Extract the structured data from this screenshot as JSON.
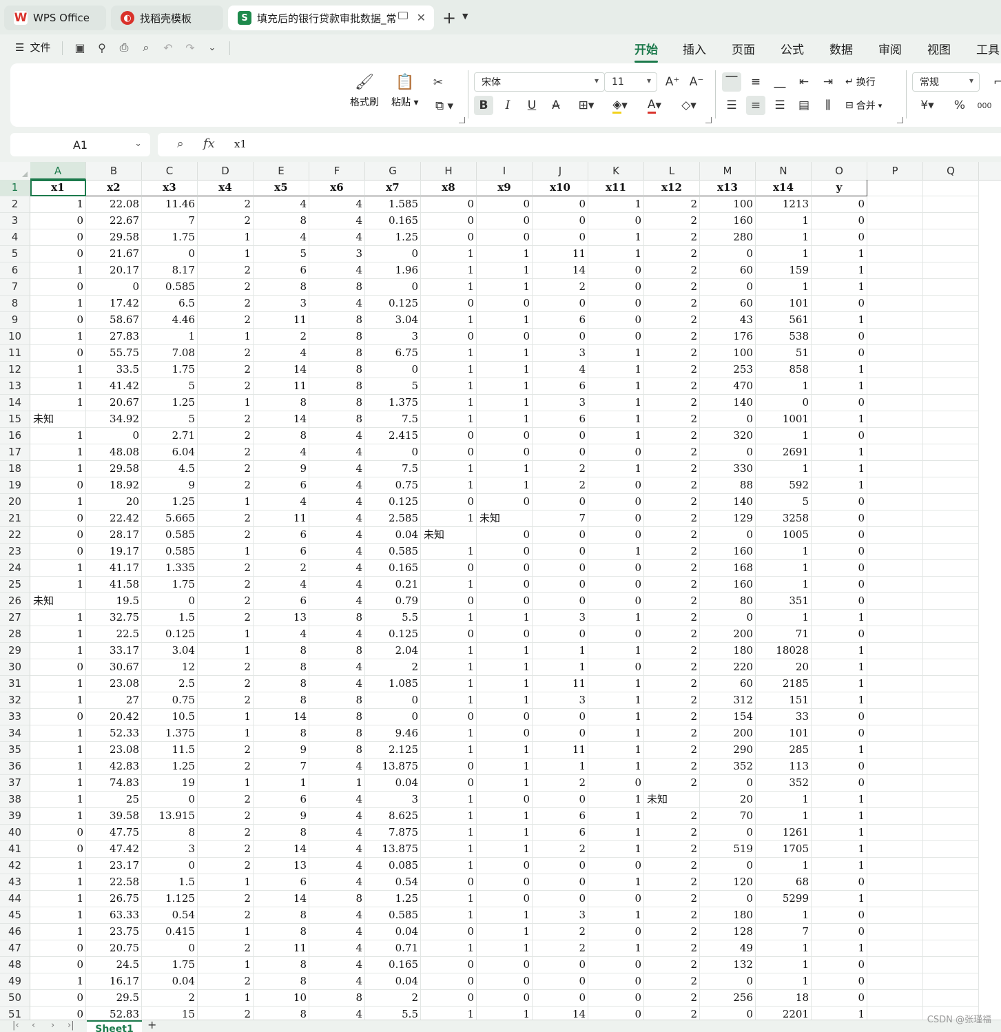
{
  "tabs": [
    {
      "label": "WPS Office",
      "icon": "wps-logo-icon"
    },
    {
      "label": "找稻壳模板",
      "icon": "docer-icon"
    },
    {
      "label": "填充后的银行贷款审批数据_常",
      "icon": "spreadsheet-icon"
    }
  ],
  "menu": {
    "file": "文件",
    "ribbon_tabs": [
      "开始",
      "插入",
      "页面",
      "公式",
      "数据",
      "审阅",
      "视图",
      "工具"
    ],
    "active_tab": "开始"
  },
  "ribbon": {
    "format_painter": "格式刷",
    "paste": "粘贴",
    "font_name": "宋体",
    "font_size": "11",
    "wrap_text": "换行",
    "merge": "合并",
    "number_format": "常规",
    "currency_symbol": "¥",
    "percent_symbol": "%",
    "thousands_symbol": "000"
  },
  "formula_bar": {
    "name_box": "A1",
    "fx": "fx",
    "value": "x1"
  },
  "sheet": {
    "columns": [
      "A",
      "B",
      "C",
      "D",
      "E",
      "F",
      "G",
      "H",
      "I",
      "J",
      "K",
      "L",
      "M",
      "N",
      "O",
      "P",
      "Q"
    ],
    "active_cell": "A1",
    "row_numbers": [
      "1",
      "2",
      "3",
      "4",
      "5",
      "6",
      "7",
      "8",
      "9",
      "10",
      "11",
      "12",
      "13",
      "14",
      "15",
      "16",
      "17",
      "18",
      "19",
      "20",
      "21",
      "22",
      "23",
      "24",
      "25",
      "26",
      "27",
      "28",
      "29",
      "30",
      "31",
      "32",
      "33",
      "34",
      "35",
      "36",
      "37",
      "38",
      "39",
      "40",
      "41",
      "42",
      "43",
      "44",
      "45",
      "46",
      "47",
      "48",
      "49",
      "50",
      "51"
    ],
    "header": [
      "x1",
      "x2",
      "x3",
      "x4",
      "x5",
      "x6",
      "x7",
      "x8",
      "x9",
      "x10",
      "x11",
      "x12",
      "x13",
      "x14",
      "y"
    ],
    "rows": [
      [
        "1",
        "22.08",
        "11.46",
        "2",
        "4",
        "4",
        "1.585",
        "0",
        "0",
        "0",
        "1",
        "2",
        "100",
        "1213",
        "0"
      ],
      [
        "0",
        "22.67",
        "7",
        "2",
        "8",
        "4",
        "0.165",
        "0",
        "0",
        "0",
        "0",
        "2",
        "160",
        "1",
        "0"
      ],
      [
        "0",
        "29.58",
        "1.75",
        "1",
        "4",
        "4",
        "1.25",
        "0",
        "0",
        "0",
        "1",
        "2",
        "280",
        "1",
        "0"
      ],
      [
        "0",
        "21.67",
        "0",
        "1",
        "5",
        "3",
        "0",
        "1",
        "1",
        "11",
        "1",
        "2",
        "0",
        "1",
        "1"
      ],
      [
        "1",
        "20.17",
        "8.17",
        "2",
        "6",
        "4",
        "1.96",
        "1",
        "1",
        "14",
        "0",
        "2",
        "60",
        "159",
        "1"
      ],
      [
        "0",
        "0",
        "0.585",
        "2",
        "8",
        "8",
        "0",
        "1",
        "1",
        "2",
        "0",
        "2",
        "0",
        "1",
        "1"
      ],
      [
        "1",
        "17.42",
        "6.5",
        "2",
        "3",
        "4",
        "0.125",
        "0",
        "0",
        "0",
        "0",
        "2",
        "60",
        "101",
        "0"
      ],
      [
        "0",
        "58.67",
        "4.46",
        "2",
        "11",
        "8",
        "3.04",
        "1",
        "1",
        "6",
        "0",
        "2",
        "43",
        "561",
        "1"
      ],
      [
        "1",
        "27.83",
        "1",
        "1",
        "2",
        "8",
        "3",
        "0",
        "0",
        "0",
        "0",
        "2",
        "176",
        "538",
        "0"
      ],
      [
        "0",
        "55.75",
        "7.08",
        "2",
        "4",
        "8",
        "6.75",
        "1",
        "1",
        "3",
        "1",
        "2",
        "100",
        "51",
        "0"
      ],
      [
        "1",
        "33.5",
        "1.75",
        "2",
        "14",
        "8",
        "0",
        "1",
        "1",
        "4",
        "1",
        "2",
        "253",
        "858",
        "1"
      ],
      [
        "1",
        "41.42",
        "5",
        "2",
        "11",
        "8",
        "5",
        "1",
        "1",
        "6",
        "1",
        "2",
        "470",
        "1",
        "1"
      ],
      [
        "1",
        "20.67",
        "1.25",
        "1",
        "8",
        "8",
        "1.375",
        "1",
        "1",
        "3",
        "1",
        "2",
        "140",
        "0",
        "0"
      ],
      [
        "未知",
        "34.92",
        "5",
        "2",
        "14",
        "8",
        "7.5",
        "1",
        "1",
        "6",
        "1",
        "2",
        "0",
        "1001",
        "1"
      ],
      [
        "1",
        "0",
        "2.71",
        "2",
        "8",
        "4",
        "2.415",
        "0",
        "0",
        "0",
        "1",
        "2",
        "320",
        "1",
        "0"
      ],
      [
        "1",
        "48.08",
        "6.04",
        "2",
        "4",
        "4",
        "0",
        "0",
        "0",
        "0",
        "0",
        "2",
        "0",
        "2691",
        "1"
      ],
      [
        "1",
        "29.58",
        "4.5",
        "2",
        "9",
        "4",
        "7.5",
        "1",
        "1",
        "2",
        "1",
        "2",
        "330",
        "1",
        "1"
      ],
      [
        "0",
        "18.92",
        "9",
        "2",
        "6",
        "4",
        "0.75",
        "1",
        "1",
        "2",
        "0",
        "2",
        "88",
        "592",
        "1"
      ],
      [
        "1",
        "20",
        "1.25",
        "1",
        "4",
        "4",
        "0.125",
        "0",
        "0",
        "0",
        "0",
        "2",
        "140",
        "5",
        "0"
      ],
      [
        "0",
        "22.42",
        "5.665",
        "2",
        "11",
        "4",
        "2.585",
        "1",
        "未知",
        "7",
        "0",
        "2",
        "129",
        "3258",
        "0"
      ],
      [
        "0",
        "28.17",
        "0.585",
        "2",
        "6",
        "4",
        "0.04",
        "未知",
        "0",
        "0",
        "0",
        "2",
        "0",
        "1005",
        "0"
      ],
      [
        "0",
        "19.17",
        "0.585",
        "1",
        "6",
        "4",
        "0.585",
        "1",
        "0",
        "0",
        "1",
        "2",
        "160",
        "1",
        "0"
      ],
      [
        "1",
        "41.17",
        "1.335",
        "2",
        "2",
        "4",
        "0.165",
        "0",
        "0",
        "0",
        "0",
        "2",
        "168",
        "1",
        "0"
      ],
      [
        "1",
        "41.58",
        "1.75",
        "2",
        "4",
        "4",
        "0.21",
        "1",
        "0",
        "0",
        "0",
        "2",
        "160",
        "1",
        "0"
      ],
      [
        "未知",
        "19.5",
        "0",
        "2",
        "6",
        "4",
        "0.79",
        "0",
        "0",
        "0",
        "0",
        "2",
        "80",
        "351",
        "0"
      ],
      [
        "1",
        "32.75",
        "1.5",
        "2",
        "13",
        "8",
        "5.5",
        "1",
        "1",
        "3",
        "1",
        "2",
        "0",
        "1",
        "1"
      ],
      [
        "1",
        "22.5",
        "0.125",
        "1",
        "4",
        "4",
        "0.125",
        "0",
        "0",
        "0",
        "0",
        "2",
        "200",
        "71",
        "0"
      ],
      [
        "1",
        "33.17",
        "3.04",
        "1",
        "8",
        "8",
        "2.04",
        "1",
        "1",
        "1",
        "1",
        "2",
        "180",
        "18028",
        "1"
      ],
      [
        "0",
        "30.67",
        "12",
        "2",
        "8",
        "4",
        "2",
        "1",
        "1",
        "1",
        "0",
        "2",
        "220",
        "20",
        "1"
      ],
      [
        "1",
        "23.08",
        "2.5",
        "2",
        "8",
        "4",
        "1.085",
        "1",
        "1",
        "11",
        "1",
        "2",
        "60",
        "2185",
        "1"
      ],
      [
        "1",
        "27",
        "0.75",
        "2",
        "8",
        "8",
        "0",
        "1",
        "1",
        "3",
        "1",
        "2",
        "312",
        "151",
        "1"
      ],
      [
        "0",
        "20.42",
        "10.5",
        "1",
        "14",
        "8",
        "0",
        "0",
        "0",
        "0",
        "1",
        "2",
        "154",
        "33",
        "0"
      ],
      [
        "1",
        "52.33",
        "1.375",
        "1",
        "8",
        "8",
        "9.46",
        "1",
        "0",
        "0",
        "1",
        "2",
        "200",
        "101",
        "0"
      ],
      [
        "1",
        "23.08",
        "11.5",
        "2",
        "9",
        "8",
        "2.125",
        "1",
        "1",
        "11",
        "1",
        "2",
        "290",
        "285",
        "1"
      ],
      [
        "1",
        "42.83",
        "1.25",
        "2",
        "7",
        "4",
        "13.875",
        "0",
        "1",
        "1",
        "1",
        "2",
        "352",
        "113",
        "0"
      ],
      [
        "1",
        "74.83",
        "19",
        "1",
        "1",
        "1",
        "0.04",
        "0",
        "1",
        "2",
        "0",
        "2",
        "0",
        "352",
        "0"
      ],
      [
        "1",
        "25",
        "0",
        "2",
        "6",
        "4",
        "3",
        "1",
        "0",
        "0",
        "1",
        "未知",
        "20",
        "1",
        "1"
      ],
      [
        "1",
        "39.58",
        "13.915",
        "2",
        "9",
        "4",
        "8.625",
        "1",
        "1",
        "6",
        "1",
        "2",
        "70",
        "1",
        "1"
      ],
      [
        "0",
        "47.75",
        "8",
        "2",
        "8",
        "4",
        "7.875",
        "1",
        "1",
        "6",
        "1",
        "2",
        "0",
        "1261",
        "1"
      ],
      [
        "0",
        "47.42",
        "3",
        "2",
        "14",
        "4",
        "13.875",
        "1",
        "1",
        "2",
        "1",
        "2",
        "519",
        "1705",
        "1"
      ],
      [
        "1",
        "23.17",
        "0",
        "2",
        "13",
        "4",
        "0.085",
        "1",
        "0",
        "0",
        "0",
        "2",
        "0",
        "1",
        "1"
      ],
      [
        "1",
        "22.58",
        "1.5",
        "1",
        "6",
        "4",
        "0.54",
        "0",
        "0",
        "0",
        "1",
        "2",
        "120",
        "68",
        "0"
      ],
      [
        "1",
        "26.75",
        "1.125",
        "2",
        "14",
        "8",
        "1.25",
        "1",
        "0",
        "0",
        "0",
        "2",
        "0",
        "5299",
        "1"
      ],
      [
        "1",
        "63.33",
        "0.54",
        "2",
        "8",
        "4",
        "0.585",
        "1",
        "1",
        "3",
        "1",
        "2",
        "180",
        "1",
        "0"
      ],
      [
        "1",
        "23.75",
        "0.415",
        "1",
        "8",
        "4",
        "0.04",
        "0",
        "1",
        "2",
        "0",
        "2",
        "128",
        "7",
        "0"
      ],
      [
        "0",
        "20.75",
        "0",
        "2",
        "11",
        "4",
        "0.71",
        "1",
        "1",
        "2",
        "1",
        "2",
        "49",
        "1",
        "1"
      ],
      [
        "0",
        "24.5",
        "1.75",
        "1",
        "8",
        "4",
        "0.165",
        "0",
        "0",
        "0",
        "0",
        "2",
        "132",
        "1",
        "0"
      ],
      [
        "1",
        "16.17",
        "0.04",
        "2",
        "8",
        "4",
        "0.04",
        "0",
        "0",
        "0",
        "0",
        "2",
        "0",
        "1",
        "0"
      ],
      [
        "0",
        "29.5",
        "2",
        "1",
        "10",
        "8",
        "2",
        "0",
        "0",
        "0",
        "0",
        "2",
        "256",
        "18",
        "0"
      ],
      [
        "0",
        "52.83",
        "15",
        "2",
        "8",
        "4",
        "5.5",
        "1",
        "1",
        "14",
        "0",
        "2",
        "0",
        "2201",
        "1"
      ]
    ]
  },
  "sheetbar": {
    "sheet_tab": "Sheet1",
    "add": "+"
  },
  "watermark": "CSDN @张瑾福",
  "colors": {
    "accent": "#1c7a4c",
    "tab_bg": "#e7ede9",
    "wps_red": "#d9322b",
    "sheet_green": "#1e8a4c"
  }
}
